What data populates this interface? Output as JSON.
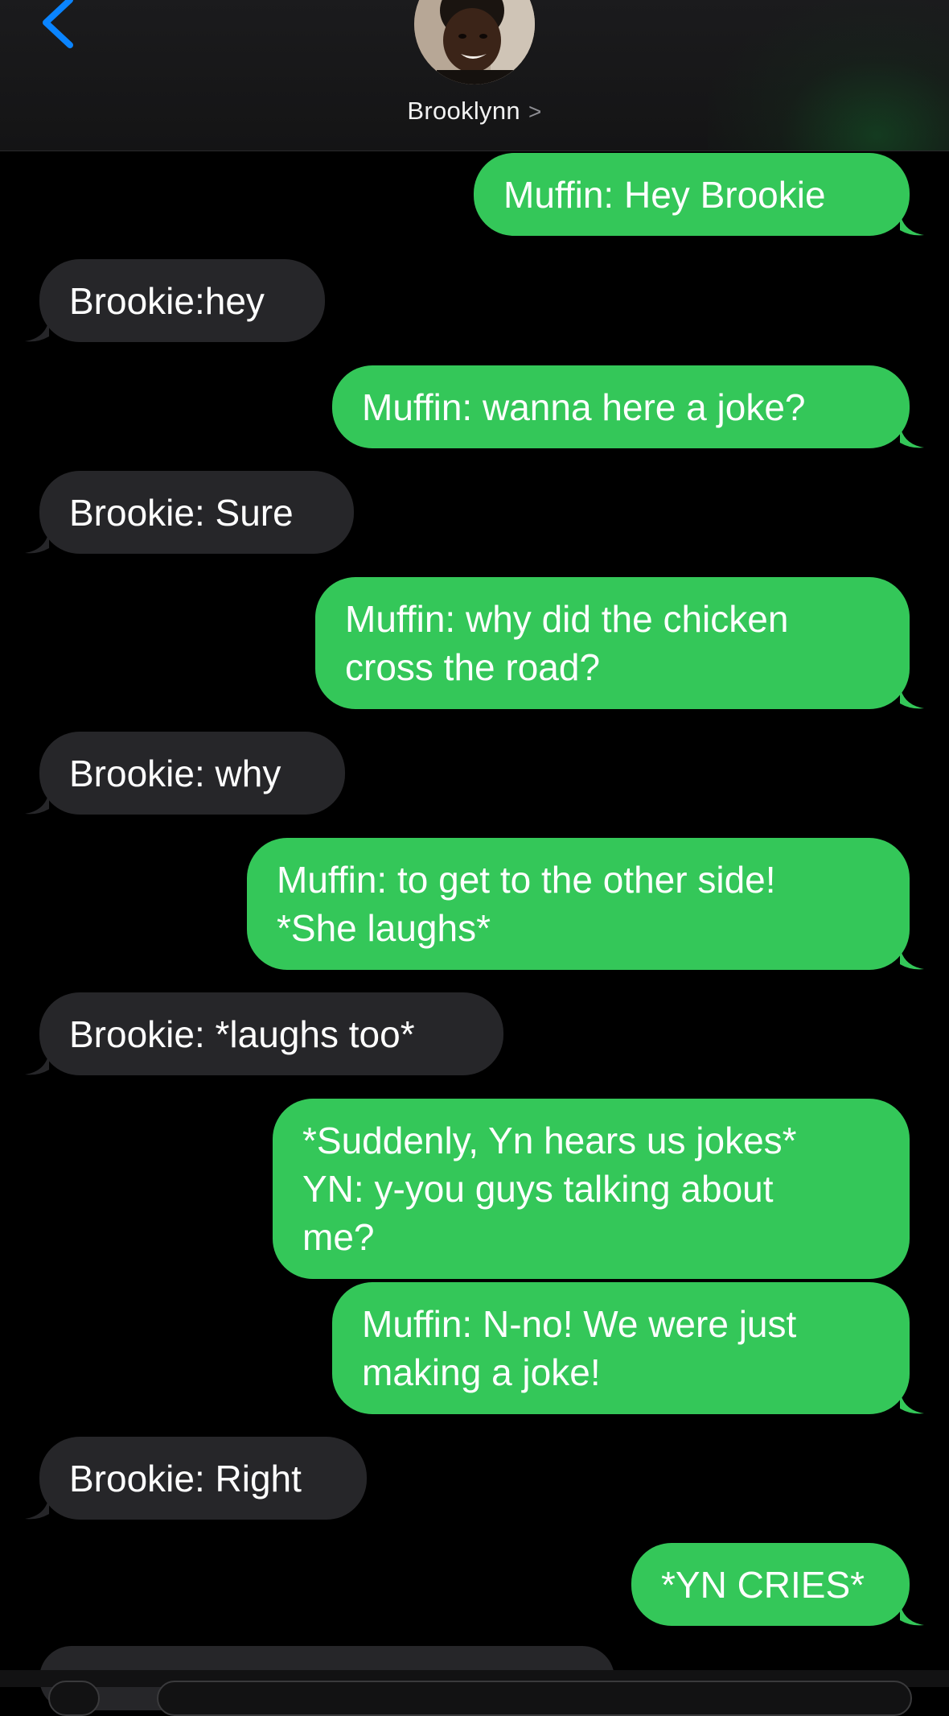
{
  "header": {
    "contact_name": "Brooklynn",
    "chevron": ">",
    "back_icon": "chevron-left-icon",
    "accent_color": "#0a84ff"
  },
  "colors": {
    "sent_bubble": "#34c759",
    "received_bubble": "#262629",
    "background": "#000000"
  },
  "messages": [
    {
      "direction": "sent",
      "text": "Muffin: Hey Brookie"
    },
    {
      "direction": "received",
      "text": "Brookie:hey"
    },
    {
      "direction": "sent",
      "text": "Muffin: wanna here a joke?"
    },
    {
      "direction": "received",
      "text": "Brookie: Sure"
    },
    {
      "direction": "sent",
      "text": "Muffin: why did the chicken\ncross the road?"
    },
    {
      "direction": "received",
      "text": "Brookie: why"
    },
    {
      "direction": "sent",
      "text": "Muffin: to get to the other side!\n*She laughs*"
    },
    {
      "direction": "received",
      "text": "Brookie: *laughs too*"
    },
    {
      "direction": "sent",
      "text": "*Suddenly, Yn hears us jokes*\nYN: y-you guys talking about\nme?"
    },
    {
      "direction": "sent",
      "text": "Muffin: N-no! We were just\nmaking a joke!"
    },
    {
      "direction": "received",
      "text": "Brookie: Right"
    },
    {
      "direction": "sent",
      "text": "*YN CRIES*"
    }
  ]
}
